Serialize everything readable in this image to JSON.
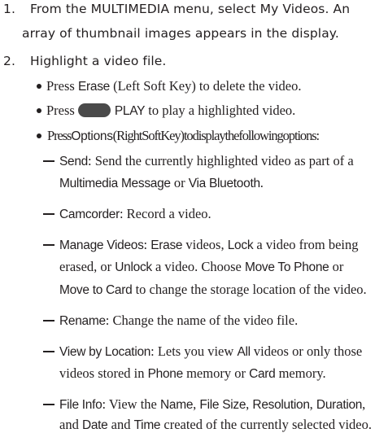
{
  "steps": [
    {
      "number": "1.",
      "line1": "From the MULTIMEDIA menu, select My Videos. An",
      "line2": "array of thumbnail images appears in the display."
    },
    {
      "number": "2.",
      "line1": "Highlight a video file."
    }
  ],
  "bullets": {
    "erase": {
      "pre": "Press ",
      "key": "Erase",
      "post": " (Left Soft Key) to delete the video."
    },
    "play": {
      "pre": "Press",
      "icon": "play-key-icon",
      "key": "PLAY",
      "post": " to play a highlighted video."
    },
    "options": {
      "pre": "Press",
      "key": "Options",
      "mid": "(RightSoftKey)",
      "post": "todisplaythefollowingoptions:"
    }
  },
  "options": {
    "send": {
      "term": "Send",
      "l1": ": Send the currently highlighted video as part of a",
      "l2a": "Multimedia Message",
      "l2b": " or ",
      "l2c": "Via Bluetooth",
      "l2d": "."
    },
    "camcorder": {
      "term": "Camcorder",
      "l1": ": Record a video."
    },
    "manage": {
      "term": "Manage Videos",
      "a": ": ",
      "erase": "Erase",
      "b": " videos, ",
      "lock": "Lock",
      "c": " a video from being",
      "d": "erased, or ",
      "unlock": "Unlock",
      "e": " a video. Choose ",
      "move_phone": "Move To Phone",
      "f": " or",
      "move_card": "Move to Card",
      "g": " to change the storage location of the video."
    },
    "rename": {
      "term": "Rename",
      "l1": ": Change the name of the video file."
    },
    "view": {
      "term": "View by Location",
      "a": ": Lets you view ",
      "all": "All",
      "b": " videos or only those",
      "c": "videos stored in ",
      "phone": "Phone",
      "d": " memory or ",
      "card": "Card",
      "e": " memory."
    },
    "fileinfo": {
      "term": "File Info",
      "a": ": View the ",
      "name": "Name",
      "b": ", ",
      "size": "File Size",
      "c": ", ",
      "res": "Resolution",
      "d": ", ",
      "dur": "Duration",
      "e": ",",
      "f": "and ",
      "date": "Date",
      "g": " and ",
      "time": "Time",
      "h": " created of the currently selected video."
    }
  }
}
